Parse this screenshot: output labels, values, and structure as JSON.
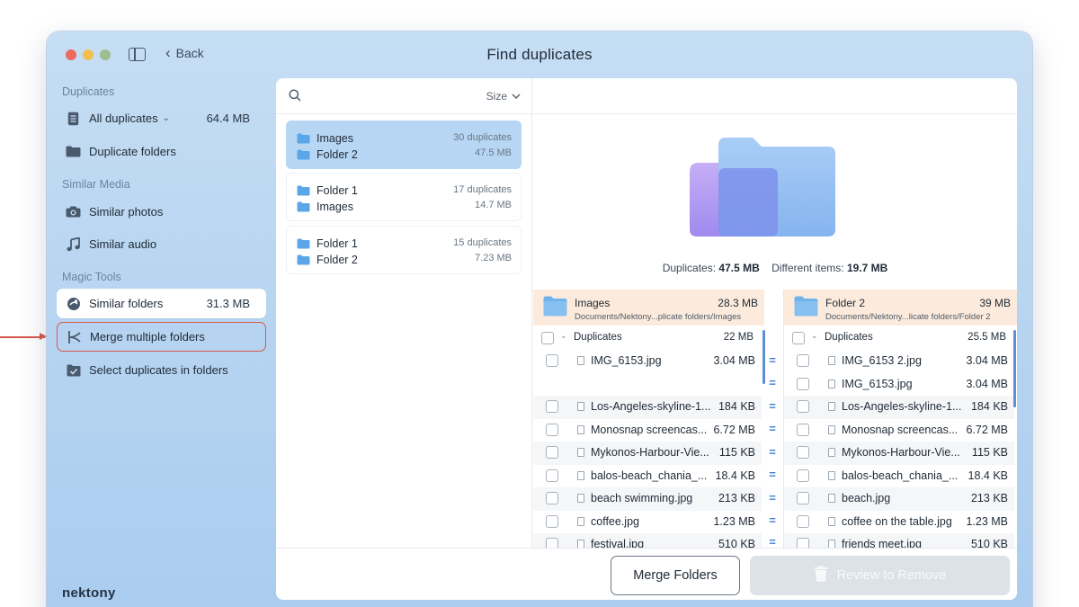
{
  "window": {
    "title": "Find duplicates",
    "back_label": "Back"
  },
  "sidebar": {
    "sections": [
      {
        "label": "Duplicates"
      },
      {
        "label": "Similar Media"
      },
      {
        "label": "Magic Tools"
      }
    ],
    "items": [
      {
        "label": "All duplicates",
        "size": "64.4 MB",
        "icon": "list-icon"
      },
      {
        "label": "Duplicate folders",
        "size": "",
        "icon": "folder-icon"
      },
      {
        "label": "Similar photos",
        "size": "",
        "icon": "camera-icon"
      },
      {
        "label": "Similar audio",
        "size": "",
        "icon": "music-note-icon"
      },
      {
        "label": "Similar folders",
        "size": "31.3 MB",
        "icon": "compare-icon"
      },
      {
        "label": "Merge multiple folders",
        "size": "",
        "icon": "merge-icon"
      },
      {
        "label": "Select duplicates in folders",
        "size": "",
        "icon": "checkbox-icon"
      }
    ],
    "logo": "nektony"
  },
  "list": {
    "sort_label": "Size",
    "pairs": [
      {
        "a": "Images",
        "b": "Folder 2",
        "count": "30 duplicates",
        "size": "47.5 MB"
      },
      {
        "a": "Folder 1",
        "b": "Images",
        "count": "17 duplicates",
        "size": "14.7 MB"
      },
      {
        "a": "Folder 1",
        "b": "Folder 2",
        "count": "15 duplicates",
        "size": "7.23 MB"
      }
    ]
  },
  "detail": {
    "summary": {
      "dup_label": "Duplicates:",
      "dup_value": "47.5 MB",
      "diff_label": "Different items:",
      "diff_value": "19.7 MB"
    },
    "left": {
      "folder": "Images",
      "path": "Documents/Nektony...plicate folders/Images",
      "size": "28.3 MB",
      "group_label": "Duplicates",
      "group_size": "22 MB",
      "rows": [
        {
          "name": "IMG_6153.jpg",
          "size": "3.04 MB"
        },
        {
          "name": "",
          "size": ""
        },
        {
          "name": "Los-Angeles-skyline-1...",
          "size": "184 KB"
        },
        {
          "name": "Monosnap screencas...",
          "size": "6.72 MB"
        },
        {
          "name": "Mykonos-Harbour-Vie...",
          "size": "115 KB"
        },
        {
          "name": "balos-beach_chania_...",
          "size": "18.4 KB"
        },
        {
          "name": "beach swimming.jpg",
          "size": "213 KB"
        },
        {
          "name": "coffee.jpg",
          "size": "1.23 MB"
        },
        {
          "name": "festival.jpg",
          "size": "510 KB"
        }
      ]
    },
    "right": {
      "folder": "Folder 2",
      "path": "Documents/Nektony...licate folders/Folder 2",
      "size": "39 MB",
      "group_label": "Duplicates",
      "group_size": "25.5 MB",
      "rows": [
        {
          "name": "IMG_6153 2.jpg",
          "size": "3.04 MB"
        },
        {
          "name": "IMG_6153.jpg",
          "size": "3.04 MB"
        },
        {
          "name": "Los-Angeles-skyline-1...",
          "size": "184 KB"
        },
        {
          "name": "Monosnap screencas...",
          "size": "6.72 MB"
        },
        {
          "name": "Mykonos-Harbour-Vie...",
          "size": "115 KB"
        },
        {
          "name": "balos-beach_chania_...",
          "size": "18.4 KB"
        },
        {
          "name": "beach.jpg",
          "size": "213 KB"
        },
        {
          "name": "coffee on the table.jpg",
          "size": "1.23 MB"
        },
        {
          "name": "friends meet.jpg",
          "size": "510 KB"
        }
      ]
    },
    "equals": "="
  },
  "footer": {
    "merge_label": "Merge Folders",
    "review_label": "Review to Remove"
  },
  "colors": {
    "accent": "#3d7fcf",
    "annotation": "#d7584b",
    "selected": "#b7d6f4",
    "header_tint": "#fcebdc"
  }
}
